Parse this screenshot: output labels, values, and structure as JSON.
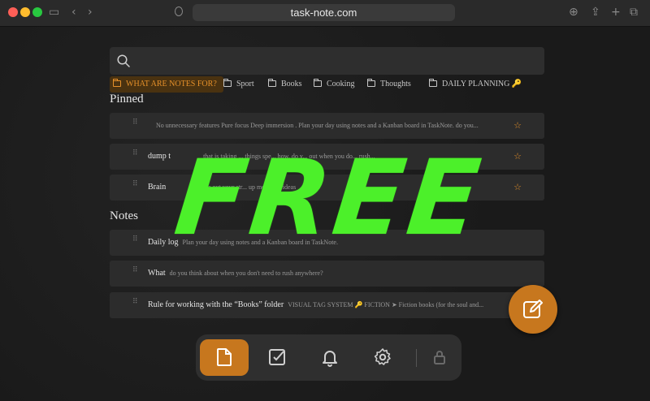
{
  "browser": {
    "url": "task-note.com"
  },
  "search": {
    "placeholder": ""
  },
  "folders": [
    {
      "label": "WHAT ARE NOTES FOR?",
      "active": true
    },
    {
      "label": "Sport",
      "active": false
    },
    {
      "label": "Books",
      "active": false
    },
    {
      "label": "Cooking",
      "active": false
    },
    {
      "label": "Thoughts",
      "active": false
    },
    {
      "label": "DAILY PLANNING 🔑",
      "active": false
    }
  ],
  "pinned": {
    "title": "Pinned",
    "items": [
      {
        "title": "",
        "preview": "No unnecessary features Pure focus Deep immersion . Plan your day using notes and a Kanban board in TaskNote. do you..."
      },
      {
        "title": "dump t",
        "preview": "that is taking ... things spe... how, do y... out when you do... rush..."
      },
      {
        "title": "Brain",
        "preview": "...ate out your str... up mental ... ideas"
      }
    ]
  },
  "notes": {
    "title": "Notes",
    "items": [
      {
        "title": "Daily log",
        "preview": "Plan your day using notes and a Kanban board in TaskNote."
      },
      {
        "title": "What",
        "preview": "do you think about when you don't need to rush anywhere?"
      },
      {
        "title": "Rule for working with the “Books” folder",
        "preview": "VISUAL TAG SYSTEM 🔑 FICTION ➤ Fiction books (for the soul and..."
      }
    ]
  },
  "overlay": {
    "text": "FREE"
  },
  "colors": {
    "accent": "#c7771e",
    "overlay": "#4cf02a",
    "star": "#e5902a"
  },
  "bottom_nav": [
    "notes-icon",
    "tasks-icon",
    "bell-icon",
    "gear-icon",
    "lock-icon"
  ]
}
